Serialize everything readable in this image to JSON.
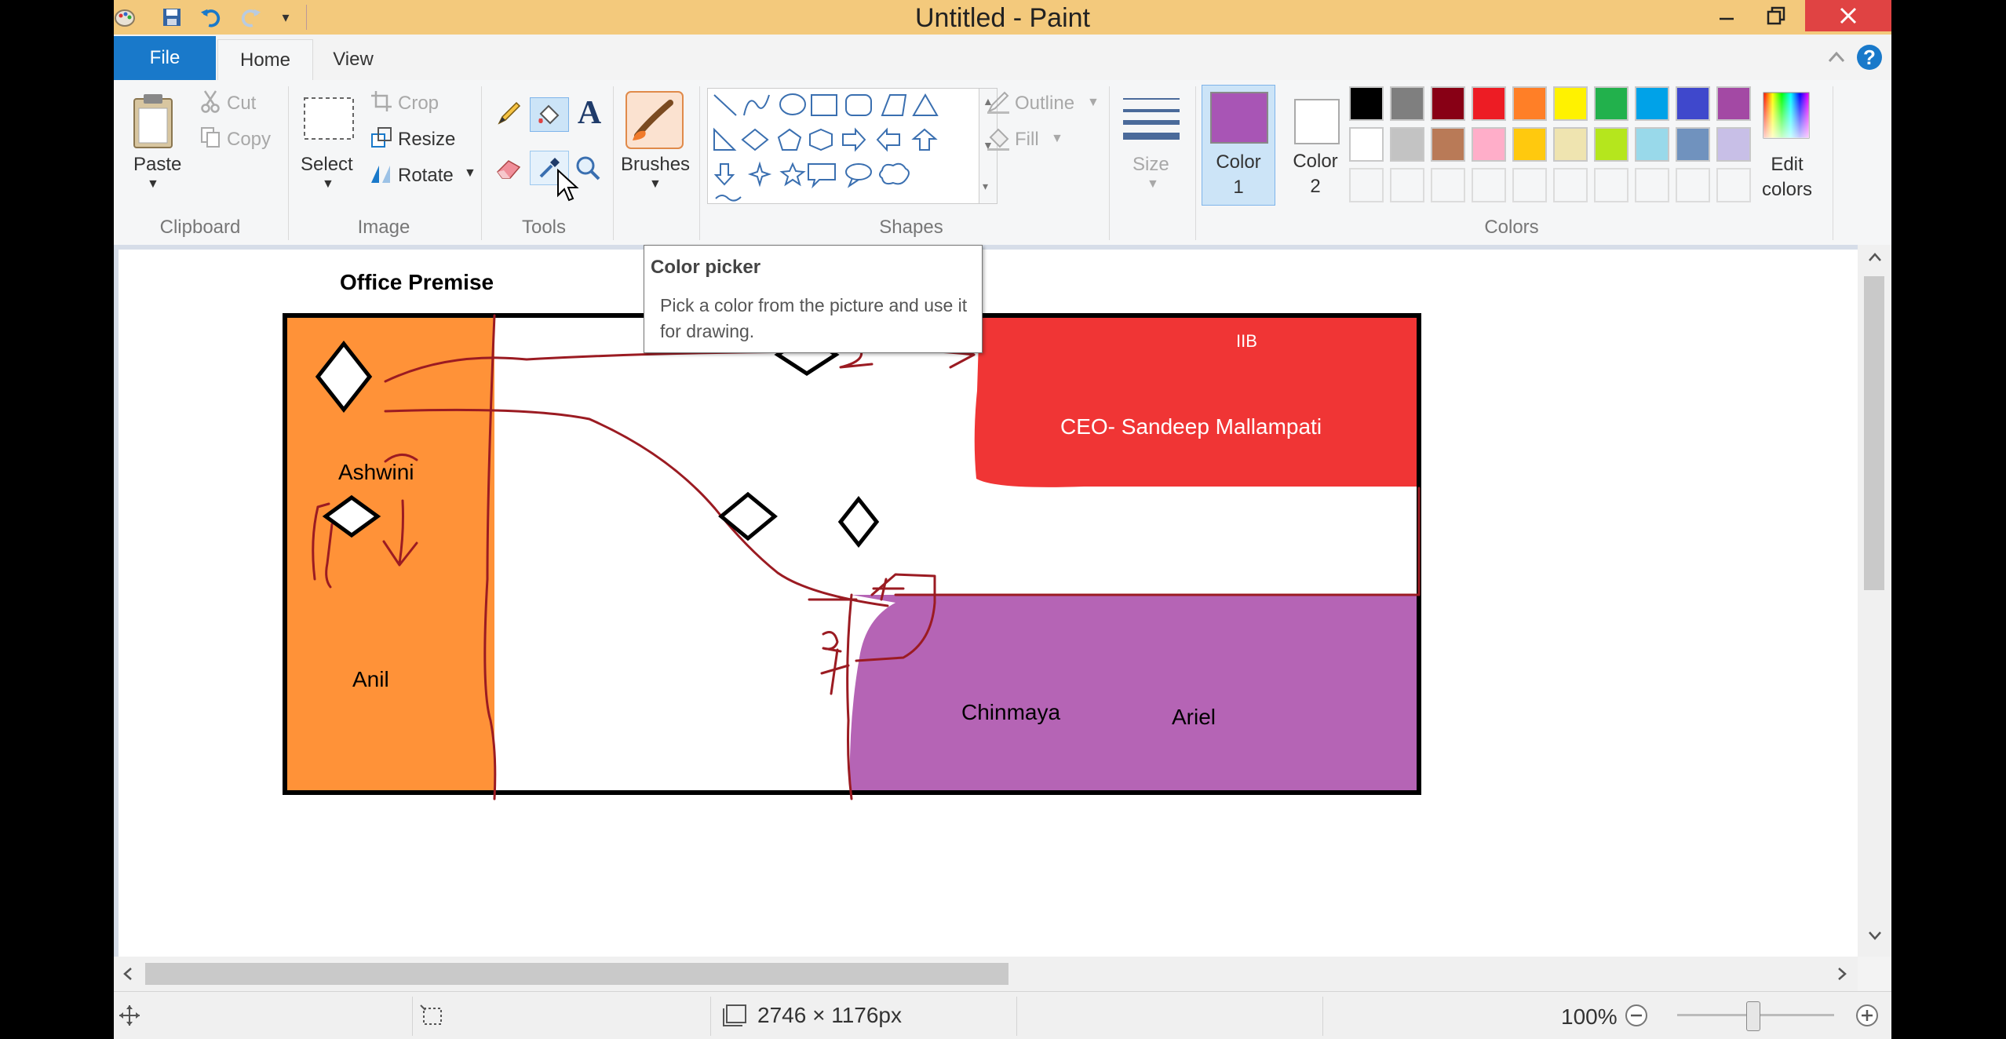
{
  "title_bar": {
    "title": "Untitled - Paint",
    "quick_access": [
      "paint-app-icon",
      "save-icon",
      "undo-icon",
      "redo-icon",
      "customize-dropdown-icon"
    ]
  },
  "tabs": {
    "file": "File",
    "home": "Home",
    "view": "View"
  },
  "ribbon": {
    "clipboard": {
      "group": "Clipboard",
      "paste": "Paste",
      "cut": "Cut",
      "copy": "Copy"
    },
    "image": {
      "group": "Image",
      "select": "Select",
      "crop": "Crop",
      "resize": "Resize",
      "rotate": "Rotate"
    },
    "tools": {
      "group": "Tools"
    },
    "brushes": {
      "label": "Brushes"
    },
    "shapes": {
      "group": "Shapes",
      "outline": "Outline",
      "fill": "Fill"
    },
    "size": {
      "label": "Size"
    },
    "colors": {
      "group": "Colors",
      "color1_line1": "Color",
      "color1_line2": "1",
      "color2_line1": "Color",
      "color2_line2": "2",
      "edit_line1": "Edit",
      "edit_line2": "colors",
      "color1_value": "#a855b5",
      "color2_value": "#ffffff",
      "palette_row1": [
        "#000000",
        "#7f7f7f",
        "#880015",
        "#ed1c24",
        "#ff7f27",
        "#fff200",
        "#22b14c",
        "#00a2e8",
        "#3f48cc",
        "#a349a4"
      ],
      "palette_row2": [
        "#ffffff",
        "#c3c3c3",
        "#b97a57",
        "#ffaec9",
        "#ffc90e",
        "#efe4b0",
        "#b5e61d",
        "#99d9ea",
        "#7092be",
        "#c8bfe7"
      ]
    }
  },
  "tooltip": {
    "title": "Color picker",
    "body": "Pick a color from the picture and use it for drawing."
  },
  "drawing": {
    "heading": "Office Premise",
    "ashwini": "Ashwini",
    "anil": "Anil",
    "ceo": "CEO- Sandeep Mallampati",
    "chinmaya": "Chinmaya",
    "ariel": "Ariel",
    "scribble": "IIB",
    "colors": {
      "orange": "#ff9238",
      "red": "#f03535",
      "purple": "#b564b5",
      "ink": "#9b1b22"
    }
  },
  "status": {
    "dimensions": "2746 × 1176px",
    "zoom": "100%"
  }
}
